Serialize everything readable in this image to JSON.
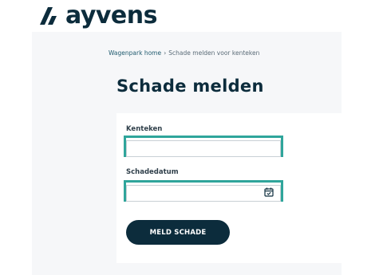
{
  "brand": {
    "name": "ayvens"
  },
  "breadcrumb": {
    "home": "Wagenpark home",
    "separator": "›",
    "current": "Schade melden voor kenteken"
  },
  "page": {
    "title": "Schade melden"
  },
  "form": {
    "kenteken": {
      "label": "Kenteken",
      "value": ""
    },
    "schadedatum": {
      "label": "Schadedatum",
      "value": ""
    },
    "submit_label": "MELD SCHADE"
  },
  "icons": {
    "logo": "ayvens-logo-icon",
    "calendar": "calendar-icon"
  },
  "colors": {
    "brand_dark": "#0c2c3c",
    "focus_border": "#2fa59b",
    "panel_bg": "#f6f7f9"
  }
}
